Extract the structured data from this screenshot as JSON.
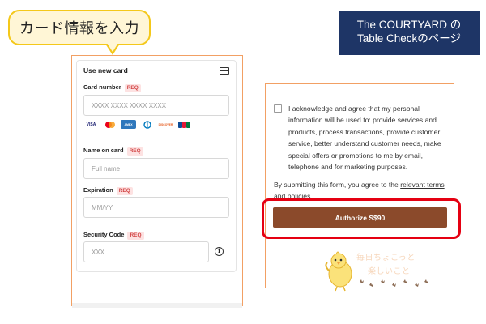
{
  "callout": {
    "text": "カード情報を入力"
  },
  "page_label": {
    "line1": "The COURTYARD の",
    "line2": "Table Checkのページ"
  },
  "card_form": {
    "title": "Use new card",
    "req_badge": "REQ",
    "card_number": {
      "label": "Card number",
      "placeholder": "XXXX XXXX XXXX XXXX"
    },
    "card_brands": [
      "VISA",
      "MC",
      "AMEX",
      "DINERS",
      "DISCOVER",
      "JCB"
    ],
    "name_on_card": {
      "label": "Name on card",
      "placeholder": "Full name"
    },
    "expiration": {
      "label": "Expiration",
      "placeholder": "MM/YY"
    },
    "security_code": {
      "label": "Security Code",
      "placeholder": "XXX"
    }
  },
  "consent": {
    "checkbox_text": "I acknowledge and agree that my personal information will be used to: provide services and products, process transactions, provide customer service, better understand customer needs, make special offers or promotions to me by email, telephone and for marketing purposes.",
    "submit_note_prefix": "By submitting this form, you agree to the ",
    "submit_note_link": "relevant terms and policies",
    "submit_note_suffix": "."
  },
  "authorize_button": {
    "label": "Authorize S$90"
  },
  "watermark": {
    "line1": "毎日ちょこっと",
    "line2": "楽しいこと"
  },
  "colors": {
    "accent_orange": "#f2a064",
    "button_brown": "#8b4a2b",
    "highlight_red": "#e50012",
    "label_navy": "#1e3566",
    "callout_yellow": "#f4c81a"
  }
}
